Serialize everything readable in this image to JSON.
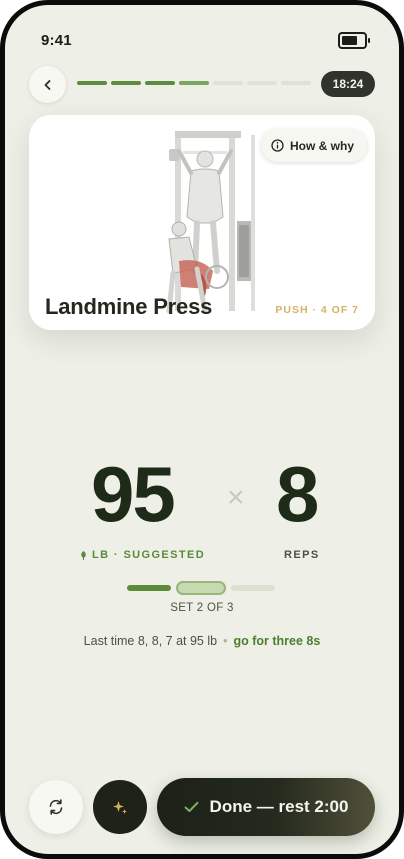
{
  "status_bar": {
    "time": "9:41"
  },
  "top_bar": {
    "timer": "18:24",
    "progress": {
      "total_segments": 7,
      "completed": 3,
      "current": 4
    }
  },
  "exercise": {
    "name": "Landmine Press",
    "meta": "PUSH · 4 OF 7",
    "how_why_label": "How & why"
  },
  "target": {
    "weight": "95",
    "weight_label": "LB · SUGGESTED",
    "times_symbol": "×",
    "reps": "8",
    "reps_label": "REPS"
  },
  "set": {
    "label": "SET 2 OF 3",
    "total": 3,
    "current": 2
  },
  "history": {
    "last_time": "Last time 8, 8, 7 at 95 lb",
    "separator": "•",
    "hint": "go for three 8s"
  },
  "actions": {
    "done_label": "Done — rest 2:00"
  },
  "colors": {
    "accent": "#5e8d3e",
    "gold": "#d4b265",
    "dark": "#1f2219",
    "background": "#eef0e7"
  },
  "icons": {
    "back": "chevron-left-icon",
    "info": "info-icon",
    "swap": "swap-icon",
    "ai": "sparkle-icon",
    "done": "check-icon",
    "weight_label": "leaf-icon"
  }
}
